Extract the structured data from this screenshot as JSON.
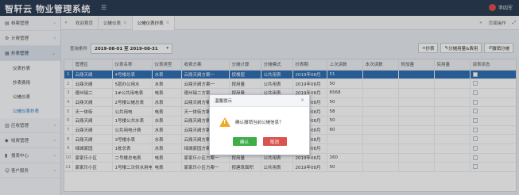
{
  "app": {
    "title": "智轩云 物业管理系统",
    "user": "李四军"
  },
  "sidebar": {
    "items": [
      {
        "label": "档案管理",
        "icon": "folder-icon"
      },
      {
        "label": "计费管理",
        "icon": "gear-icon"
      },
      {
        "label": "抄表管理",
        "icon": "meter-icon"
      },
      {
        "label": "应收管理",
        "icon": "receivable-icon"
      },
      {
        "label": "收费管理",
        "icon": "coin-icon"
      },
      {
        "label": "报表中心",
        "icon": "chart-icon"
      },
      {
        "label": "客户服务",
        "icon": "service-icon"
      }
    ],
    "sub_items": [
      {
        "label": "仪表抄表"
      },
      {
        "label": "抄表费用"
      },
      {
        "label": "公摊仪表"
      },
      {
        "label": "公摊仪表抄表"
      }
    ]
  },
  "tabs": {
    "items": [
      {
        "label": "欢迎首页"
      },
      {
        "label": "公摊仪表"
      },
      {
        "label": "公摊仪表抄表"
      }
    ],
    "page_ops": "页面操作"
  },
  "toolbar": {
    "query_label": "查询条件",
    "date_range": "2019-08-01 至 2019-08-31",
    "buttons": [
      "抄表",
      "分摊用量&费用",
      "撤销分摊"
    ]
  },
  "table": {
    "headers": [
      "",
      "管理区",
      "仪表名称",
      "仪表类型",
      "收费方案",
      "分摊计算",
      "分摊模式",
      "抄表期",
      "上次读数",
      "本次读数",
      "附加量",
      "实用量",
      "读表状态"
    ],
    "rows": [
      [
        "1",
        "云鼎天阙",
        "4号楼总表",
        "水表",
        "云鼎天阙方案一",
        "按楼层",
        "公共用表",
        "2019年08月",
        "51",
        "",
        "",
        "",
        ""
      ],
      [
        "2",
        "云鼎天阙",
        "5层办公用水",
        "水表",
        "云鼎天阙方案一",
        "按用量",
        "公共用表",
        "2019年08月",
        "50",
        "",
        "",
        "",
        ""
      ],
      [
        "3",
        "德州瑞二",
        "1#公共用电表",
        "电表",
        "德州瑞二方案",
        "按用量",
        "公共用表",
        "2019年08月",
        "6568",
        "",
        "",
        "",
        ""
      ],
      [
        "4",
        "云鼎天阙",
        "2号楼公摊总表",
        "水表",
        "云鼎天阙方案一",
        "按面积",
        "公共用表",
        "2019年08月",
        "50",
        "",
        "",
        "",
        ""
      ],
      [
        "5",
        "天一体街",
        "公共用电",
        "电表",
        "天一体街方案",
        "按面积",
        "公共用表",
        "2019年08月",
        "58",
        "",
        "",
        "",
        ""
      ],
      [
        "6",
        "云鼎天阙",
        "1号楼公共水表",
        "水表",
        "云鼎天阙方案一",
        "按用量",
        "公共用表",
        "2019年08月",
        "50",
        "",
        "",
        "",
        ""
      ],
      [
        "7",
        "云鼎天阙",
        "公共用电计费",
        "水表",
        "云鼎天阙方案一",
        "按面积",
        "公共用表",
        "2019年08月",
        "60",
        "",
        "",
        "",
        ""
      ],
      [
        "8",
        "云鼎天阙",
        "3号楼水表",
        "水表",
        "云鼎天阙方案一",
        "按面积",
        "公共用表",
        "2019年08月",
        "",
        "",
        "",
        "",
        ""
      ],
      [
        "9",
        "绿城家园",
        "1栋总表",
        "水表",
        "绿城家园方案",
        "按面积",
        "公共用表",
        "2019年08月",
        "",
        "",
        "",
        "",
        ""
      ],
      [
        "10",
        "家家乐小区",
        "二号楼总电表",
        "电表",
        "家家乐小区方案一",
        "按用量",
        "公共用表",
        "2019年08月",
        "160",
        "",
        "",
        "",
        ""
      ],
      [
        "11",
        "家家乐小区",
        "1号楼二次供水用电",
        "电表",
        "家家乐小区方案一",
        "按建筑面积",
        "公共用表",
        "2019年08月",
        "50",
        "",
        "",
        "",
        ""
      ]
    ]
  },
  "dialog": {
    "title": "温馨提示",
    "message": "确认撤销当前公摊信息？",
    "ok": "确认",
    "cancel": "取消"
  }
}
